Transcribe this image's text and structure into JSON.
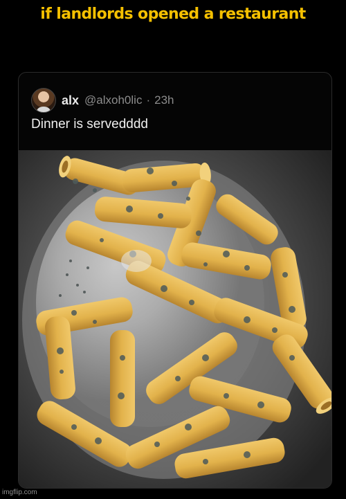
{
  "meme": {
    "caption": "if landlords opened a restaurant"
  },
  "tweet": {
    "display_name": "alx",
    "handle": "@alxoh0lic",
    "separator": "·",
    "time": "23h",
    "text": "Dinner is servedddd"
  },
  "watermark": "imgflip.com",
  "colors": {
    "caption": "#f5c000",
    "background": "#000000",
    "pasta": "#e6b84f",
    "mold": "#4d5a5a"
  }
}
